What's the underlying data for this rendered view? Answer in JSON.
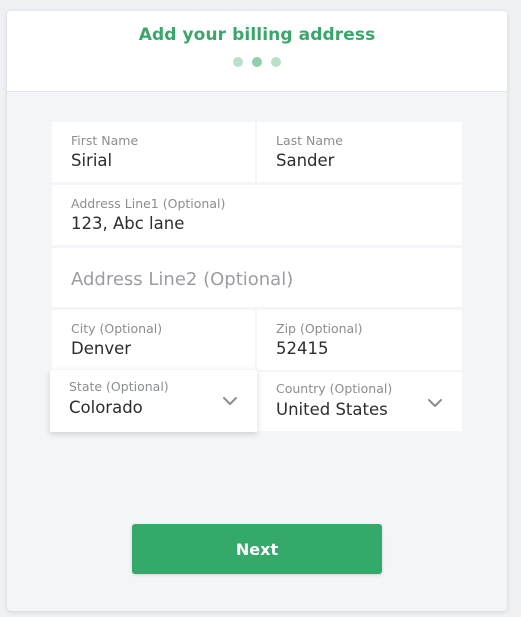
{
  "header": {
    "title": "Add your billing address",
    "steps": {
      "total": 3,
      "current": 2
    }
  },
  "form": {
    "first_name": {
      "label": "First Name",
      "value": "Sirial"
    },
    "last_name": {
      "label": "Last Name",
      "value": "Sander"
    },
    "address_line1": {
      "label": "Address Line1 (Optional)",
      "value": "123, Abc lane"
    },
    "address_line2": {
      "placeholder": "Address Line2 (Optional)",
      "value": ""
    },
    "city": {
      "label": "City (Optional)",
      "value": "Denver"
    },
    "zip": {
      "label": "Zip (Optional)",
      "value": "52415"
    },
    "state": {
      "label": "State (Optional)",
      "value": "Colorado",
      "icon": "chevron-down-icon"
    },
    "country": {
      "label": "Country (Optional)",
      "value": "United States",
      "icon": "chevron-down-icon"
    }
  },
  "actions": {
    "next_label": "Next"
  },
  "colors": {
    "accent": "#35a96a",
    "title": "#3aa66a",
    "dot_active": "#8fd0aa",
    "dot_inactive": "#b9e0c8"
  }
}
